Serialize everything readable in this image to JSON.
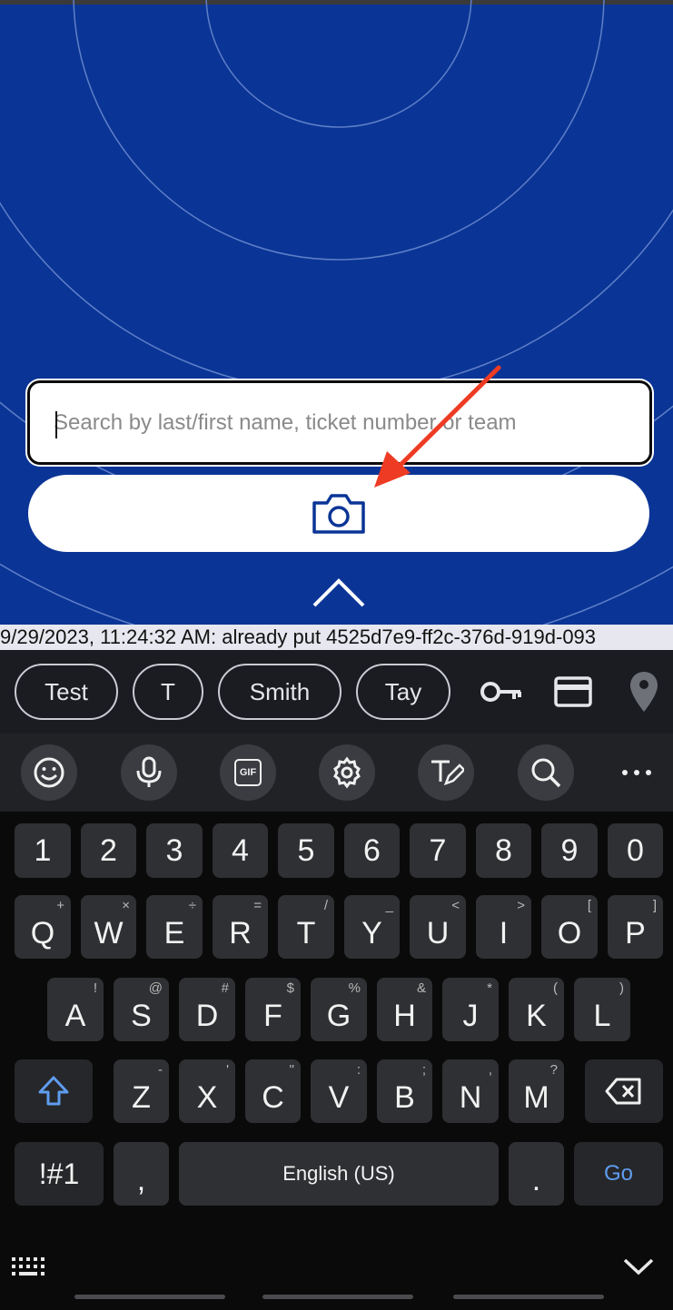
{
  "app": {
    "search": {
      "placeholder": "Search by last/first name, ticket number or team",
      "value": ""
    },
    "icons": {
      "camera": "camera-icon",
      "expand": "chevron-up-icon",
      "annotation": "red-arrow"
    },
    "colors": {
      "background": "#0a3596",
      "ring": "#5f7fc8",
      "arrow": "#ee3b24"
    }
  },
  "log": {
    "text": "9/29/2023, 11:24:32 AM: already put 4525d7e9-ff2c-376d-919d-093"
  },
  "suggestions": {
    "chips": [
      "Test",
      "T",
      "Smith",
      "Tay"
    ],
    "icons": [
      "key-icon",
      "credit-card-icon",
      "location-pin-icon"
    ]
  },
  "toolbar": {
    "icons": [
      "emoji-icon",
      "microphone-icon",
      "gif-icon",
      "gear-icon",
      "handwriting-icon",
      "search-icon",
      "more-icon"
    ],
    "gif_label": "GIF"
  },
  "keyboard": {
    "numbers": [
      "1",
      "2",
      "3",
      "4",
      "5",
      "6",
      "7",
      "8",
      "9",
      "0"
    ],
    "row1": [
      {
        "k": "Q",
        "a": "+"
      },
      {
        "k": "W",
        "a": "×"
      },
      {
        "k": "E",
        "a": "÷"
      },
      {
        "k": "R",
        "a": "="
      },
      {
        "k": "T",
        "a": "/"
      },
      {
        "k": "Y",
        "a": "_"
      },
      {
        "k": "U",
        "a": "<"
      },
      {
        "k": "I",
        "a": ">"
      },
      {
        "k": "O",
        "a": "["
      },
      {
        "k": "P",
        "a": "]"
      }
    ],
    "row2": [
      {
        "k": "A",
        "a": "!"
      },
      {
        "k": "S",
        "a": "@"
      },
      {
        "k": "D",
        "a": "#"
      },
      {
        "k": "F",
        "a": "$"
      },
      {
        "k": "G",
        "a": "%"
      },
      {
        "k": "H",
        "a": "&"
      },
      {
        "k": "J",
        "a": "*"
      },
      {
        "k": "K",
        "a": "("
      },
      {
        "k": "L",
        "a": ")"
      }
    ],
    "row3": [
      {
        "k": "Z",
        "a": "-"
      },
      {
        "k": "X",
        "a": "'"
      },
      {
        "k": "C",
        "a": "\""
      },
      {
        "k": "V",
        "a": ":"
      },
      {
        "k": "B",
        "a": ";"
      },
      {
        "k": "N",
        "a": ","
      },
      {
        "k": "M",
        "a": "?"
      }
    ],
    "symbols_label": "!#1",
    "comma_label": ",",
    "space_label": "English (US)",
    "period_label": ".",
    "go_label": "Go",
    "icons": [
      "shift-icon",
      "backspace-icon",
      "keyboard-layout-icon",
      "hide-keyboard-icon"
    ]
  }
}
